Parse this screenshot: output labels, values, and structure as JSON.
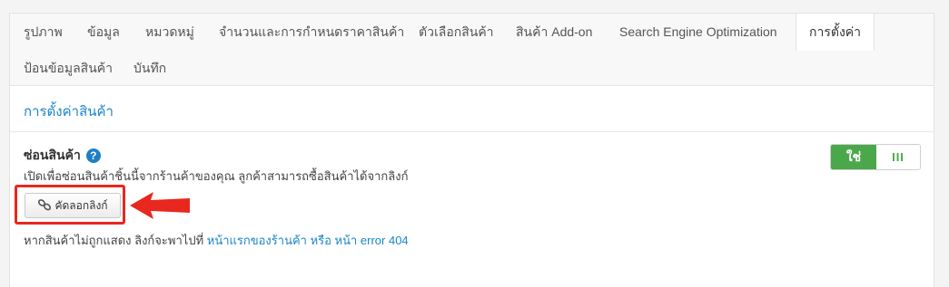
{
  "tabs": {
    "row1": [
      "รูปภาพ",
      "ข้อมูล",
      "หมวดหมู่",
      "จำนวนและการกำหนดราคาสินค้า",
      "ตัวเลือกสินค้า",
      "สินค้า Add-on",
      "Search Engine Optimization",
      "การตั้งค่า"
    ],
    "row2": [
      "ป้อนข้อมูลสินค้า",
      "บันทึก"
    ],
    "active": "การตั้งค่า"
  },
  "section": {
    "title": "การตั้งค่าสินค้า"
  },
  "hide_product": {
    "label": "ซ่อนสินค้า",
    "help_icon": "?",
    "description": "เปิดเพื่อซ่อนสินค้าชิ้นนี้จากร้านค้าของคุณ ลูกค้าสามารถซื้อสินค้าได้จากลิงก์",
    "copy_button": "คัดลอกลิงก์",
    "note_prefix": "หากสินค้าไม่ถูกแสดง ลิงก์จะพาไปที่ ",
    "note_link1": "หน้าแรกของร้านค้า",
    "note_or": " หรือ ",
    "note_link2": "หน้า error 404",
    "toggle_on": "ใช่",
    "toggle_off": "III"
  },
  "colors": {
    "accent_link": "#1a86c8",
    "toggle_green": "#4aa84a",
    "annotation_red": "#e8281e"
  },
  "icons": [
    "help-icon",
    "link-chain-icon",
    "annotation-arrow"
  ]
}
